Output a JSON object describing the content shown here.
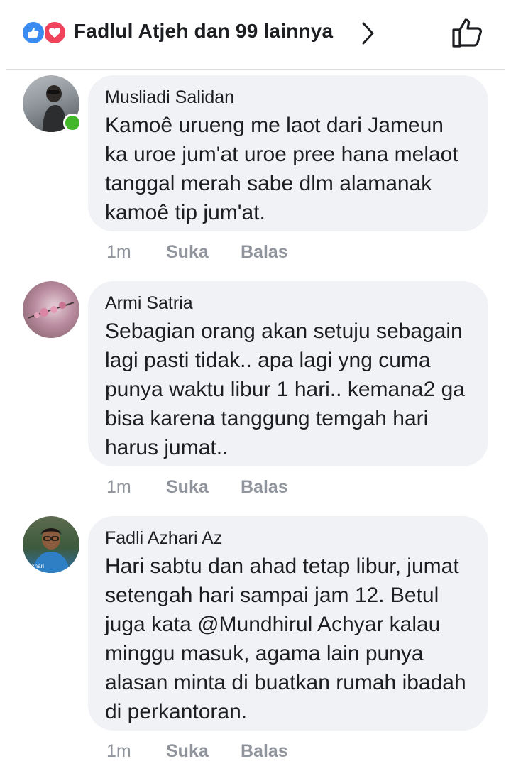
{
  "header": {
    "reactors_text": "Fadlul Atjeh dan 99 lainnya",
    "reaction_icons": [
      "like-icon",
      "love-icon"
    ],
    "colors": {
      "like": "#3b8cf2",
      "love": "#f0445c"
    }
  },
  "comments": [
    {
      "author": "Musliadi Salidan",
      "text": "Kamoê urueng me laot dari Jameun ka uroe jum'at uroe pree hana melaot tanggal merah sabe dlm alamanak kamoê tip jum'at.",
      "time": "1m",
      "like_label": "Suka",
      "reply_label": "Balas",
      "online": true
    },
    {
      "author": "Armi Satria",
      "text": "Sebagian orang akan setuju sebagain lagi pasti tidak.. apa lagi yng cuma punya waktu libur 1 hari.. kemana2 ga bisa karena tanggung temgah hari harus jumat..",
      "time": "1m",
      "like_label": "Suka",
      "reply_label": "Balas",
      "online": false
    },
    {
      "author": "Fadli Azhari Az",
      "avatar_caption": "li Azhari",
      "text": "Hari sabtu dan ahad tetap libur, jumat setengah hari sampai jam 12. Betul juga kata @Mundhirul Achyar kalau minggu masuk, agama lain punya alasan minta di buatkan rumah ibadah di perkantoran.",
      "time": "1m",
      "like_label": "Suka",
      "reply_label": "Balas",
      "online": false
    }
  ]
}
